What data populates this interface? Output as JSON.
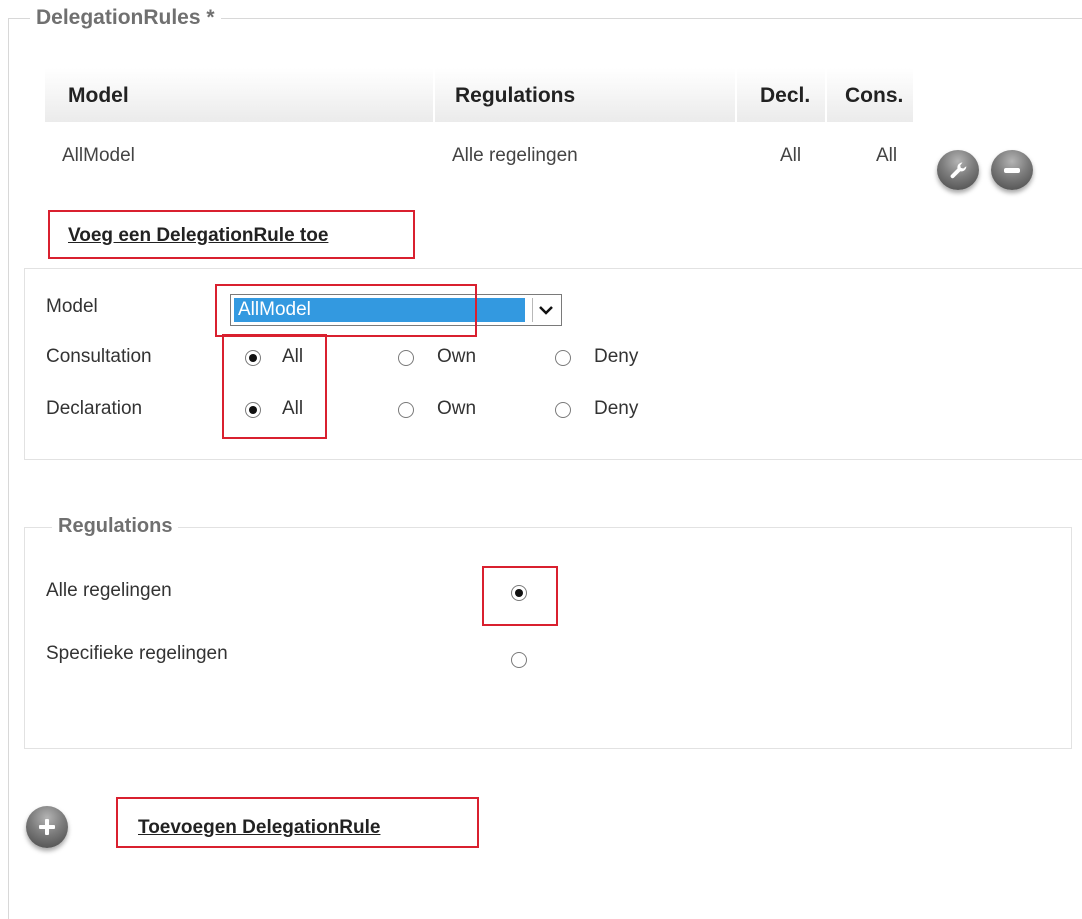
{
  "fieldset": {
    "legend": "DelegationRules *"
  },
  "table": {
    "headers": [
      "Model",
      "Regulations",
      "Decl.",
      "Cons."
    ],
    "rows": [
      {
        "model": "AllModel",
        "regulations": "Alle regelingen",
        "decl": "All",
        "cons": "All"
      }
    ]
  },
  "add_rule_link": "Voeg een DelegationRule toe",
  "form": {
    "model_label": "Model",
    "model_value": "AllModel",
    "consultation_label": "Consultation",
    "declaration_label": "Declaration",
    "options": [
      "All",
      "Own",
      "Deny"
    ],
    "consultation_selected": "All",
    "declaration_selected": "All"
  },
  "regulations": {
    "legend": "Regulations",
    "all_label": "Alle regelingen",
    "specific_label": "Specifieke regelingen",
    "selected": "all"
  },
  "add_button_link": "Toevoegen DelegationRule",
  "colors": {
    "highlight_box": "#d9202f",
    "select_highlight": "#3399e0"
  }
}
